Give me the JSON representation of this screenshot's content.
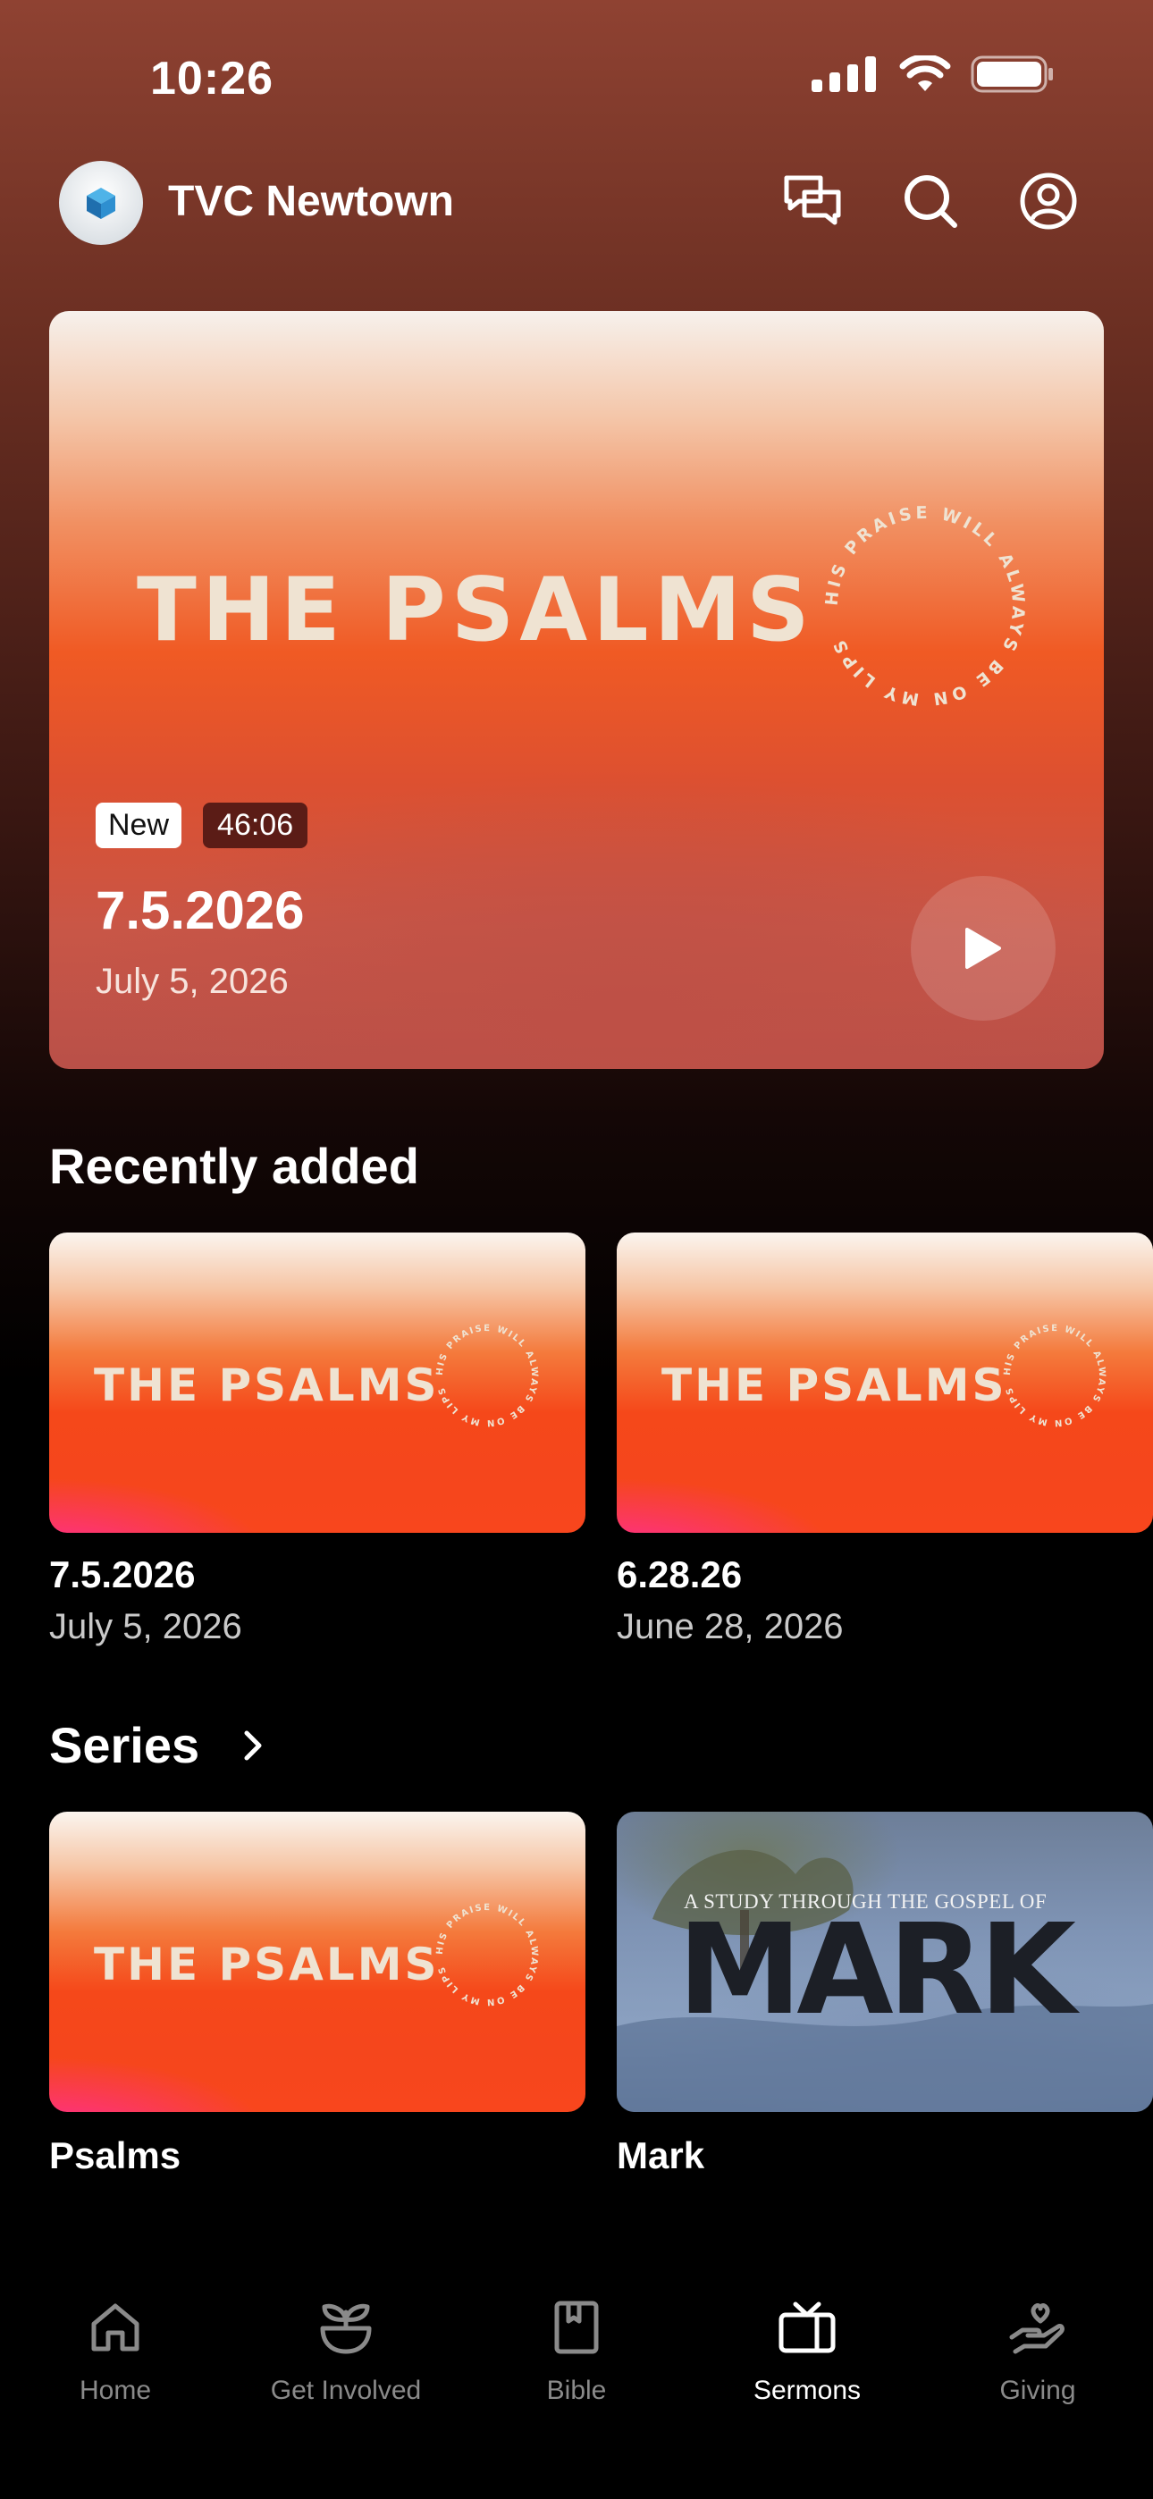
{
  "status_bar": {
    "time": "10:26"
  },
  "header": {
    "title": "TVC Newtown",
    "logo_icon": "church-logo-icon",
    "actions": [
      "chat-icon",
      "search-icon",
      "profile-icon"
    ]
  },
  "featured": {
    "series_title": "THE PSALMS",
    "tagline": "HIS PRAISE WILL ALWAYS BE ON MY LIPS",
    "badge_new": "New",
    "duration": "46:06",
    "title": "7.5.2026",
    "date": "July 5, 2026"
  },
  "recently_added": {
    "heading": "Recently added",
    "items": [
      {
        "thumb_title": "THE PSALMS",
        "tagline": "HIS PRAISE WILL ALWAYS BE ON MY LIPS",
        "title": "7.5.2026",
        "date": "July 5, 2026"
      },
      {
        "thumb_title": "THE PSALMS",
        "tagline": "HIS PRAISE WILL ALWAYS BE ON MY LIPS",
        "title": "6.28.26",
        "date": "June 28, 2026"
      }
    ]
  },
  "series": {
    "heading": "Series",
    "items": [
      {
        "thumb_title": "THE PSALMS",
        "tagline": "HIS PRAISE WILL ALWAYS BE ON MY LIPS",
        "label": "Psalms"
      },
      {
        "thumb_subtitle": "A STUDY THROUGH THE GOSPEL OF",
        "thumb_title": "MARK",
        "label": "Mark"
      }
    ]
  },
  "tab_bar": {
    "active": "Sermons",
    "tabs": [
      {
        "label": "Home",
        "icon": "home-icon"
      },
      {
        "label": "Get Involved",
        "icon": "sprout-icon"
      },
      {
        "label": "Bible",
        "icon": "bible-icon"
      },
      {
        "label": "Sermons",
        "icon": "tv-icon"
      },
      {
        "label": "Giving",
        "icon": "giving-icon"
      }
    ]
  },
  "colors": {
    "accent_orange": "#f05a24",
    "header_bg": "#8f4232",
    "badge_dark": "#5b1c16"
  }
}
